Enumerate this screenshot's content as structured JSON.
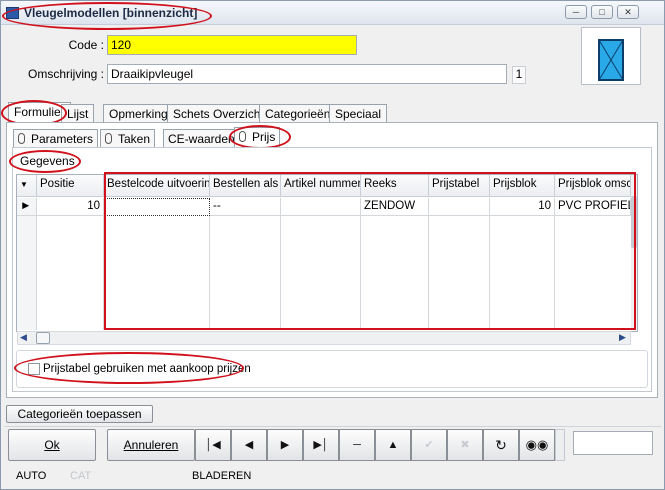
{
  "window": {
    "title": "Vleugelmodellen [binnenzicht]",
    "controls": [
      "minimize-icon",
      "maximize-icon",
      "close-icon"
    ]
  },
  "form": {
    "code_label": "Code :",
    "code_value": "120",
    "code_highlight_color": "#ffff00",
    "omschrijving_label": "Omschrijving :",
    "omschrijving_value": "Draaikipvleugel",
    "count_value": "1",
    "preview_icon": "window-sash-icon"
  },
  "tabs": [
    "Formulier",
    "Lijst",
    "Opmerking",
    "Schets Overzicht",
    "Categorieën",
    "Speciaal"
  ],
  "active_tab": "Formulier",
  "subtabs": [
    "Parameters",
    "Taken",
    "CE-waarden",
    "Prijs"
  ],
  "active_subtab": "Prijs",
  "section_title": "Gegevens",
  "grid": {
    "columns": [
      "Positie",
      "Bestelcode uitvoering",
      "Bestellen als",
      "Artikel nummer",
      "Reeks",
      "Prijstabel",
      "Prijsblok",
      "Prijsblok omsch"
    ],
    "rows": [
      {
        "positie": "10",
        "bestelcode": "",
        "bestellen_als": "--",
        "artikel": "",
        "reeks": "ZENDOW",
        "prijstabel": "",
        "prijsblok": "10",
        "prijsblok_omsch": "PVC PROFIELE"
      }
    ]
  },
  "checkbox": {
    "label": "Prijstabel gebruiken met aankoop prijzen",
    "checked": false
  },
  "apply_button": "Categorieën toepassen",
  "buttons": {
    "ok": "Ok",
    "cancel": "Annuleren"
  },
  "nav_icons": [
    "first-record-icon",
    "previous-record-icon",
    "next-record-icon",
    "last-record-icon",
    "delete-record-icon",
    "up-icon",
    "confirm-icon",
    "cancel-icon",
    "refresh-icon",
    "binoculars-icon"
  ],
  "status": {
    "mode": "AUTO",
    "cat": "CAT",
    "state": "BLADEREN"
  },
  "annotation_color": "#d0101a"
}
